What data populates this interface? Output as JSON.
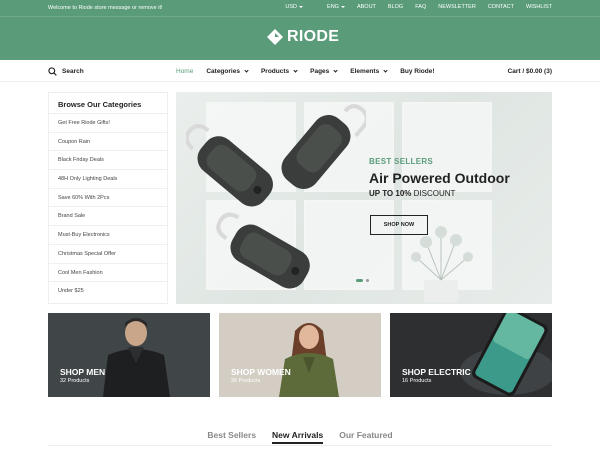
{
  "topbar": {
    "welcome": "Welcome to Riode store message or remove it!",
    "currency": "USD",
    "language": "ENG",
    "links": [
      "ABOUT",
      "BLOG",
      "FAQ",
      "NEWSLETTER",
      "CONTACT",
      "WISHLIST"
    ]
  },
  "brand": {
    "name": "RIODE",
    "color": "#5a9c7a"
  },
  "nav": {
    "search_label": "Search",
    "items": [
      {
        "label": "Home",
        "active": true
      },
      {
        "label": "Categories"
      },
      {
        "label": "Products"
      },
      {
        "label": "Pages"
      },
      {
        "label": "Elements"
      },
      {
        "label": "Buy Riode!"
      }
    ],
    "cart": "Cart / $0.00 (3)"
  },
  "sidebar": {
    "title": "Browse Our Categories",
    "items": [
      "Get Free Riode Gifts!",
      "Coupon Rain",
      "Black Friday Deals",
      "48H Only Lighting Deals",
      "Save 60% With 2Pcs",
      "Brand Sale",
      "Must-Buy Electronics",
      "Christmas Special Offer",
      "Cool Men Fashion",
      "Under $25"
    ]
  },
  "hero": {
    "tag": "BEST SELLERS",
    "title": "Air Powered Outdoor",
    "sub_bold": "UP TO 10%",
    "sub_rest": "DISCOUNT",
    "button": "SHOP NOW",
    "slide_count": 2,
    "active_slide": 1
  },
  "banners": [
    {
      "title": "SHOP MEN",
      "count": "32 Products"
    },
    {
      "title": "SHOP WOMEN",
      "count": "26 Products"
    },
    {
      "title": "SHOP ELECTRIC",
      "count": "16 Products"
    }
  ],
  "tabs": [
    {
      "label": "Best Sellers"
    },
    {
      "label": "New Arrivals",
      "active": true
    },
    {
      "label": "Our Featured"
    }
  ]
}
